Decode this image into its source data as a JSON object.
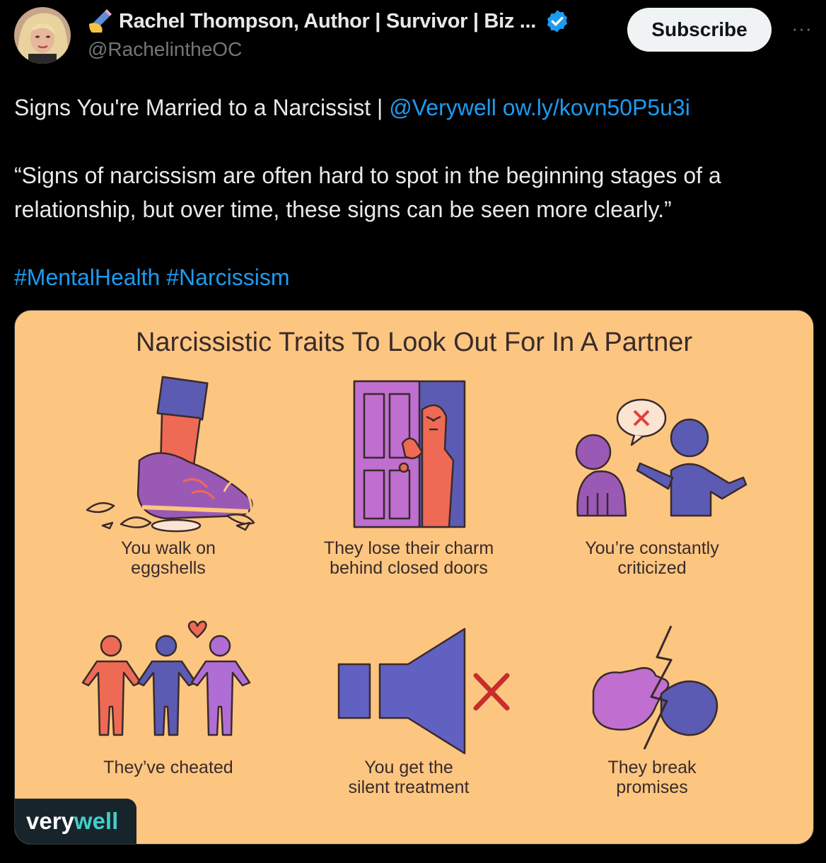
{
  "author": {
    "emoji": "✍️",
    "display_name": "Rachel Thompson, Author | Survivor | Biz ...",
    "handle": "@RachelintheOC",
    "verified_icon": "verified-badge-icon"
  },
  "actions": {
    "subscribe_label": "Subscribe",
    "more_label": "···"
  },
  "tweet": {
    "line1_text": "Signs You're Married to a Narcissist | ",
    "line1_mention": "@Verywell",
    "line1_link": "ow.ly/kovn50P5u3i",
    "quote_line1": "“Signs of narcissism are often hard to spot in the beginning stages of a",
    "quote_line2": "relationship, but over time, these signs can be seen more clearly.”",
    "hashtag1": "#MentalHealth",
    "hashtag2": "#Narcissism"
  },
  "infographic": {
    "title": "Narcissistic Traits To Look Out For In A Partner",
    "items": [
      {
        "line1": "You walk on",
        "line2": "eggshells"
      },
      {
        "line1": "They lose their charm",
        "line2": "behind closed doors"
      },
      {
        "line1": "You’re constantly",
        "line2": "criticized"
      },
      {
        "line1": "They’ve cheated",
        "line2": ""
      },
      {
        "line1": "You get the",
        "line2": "silent treatment"
      },
      {
        "line1": "They break",
        "line2": "promises"
      }
    ],
    "brand_part1": "very",
    "brand_part2": "well",
    "colors": {
      "background": "#fcc681",
      "purple": "#9b59b6",
      "indigo": "#5b5bb3",
      "coral": "#ee6a55",
      "ink": "#3a2a2a"
    }
  }
}
